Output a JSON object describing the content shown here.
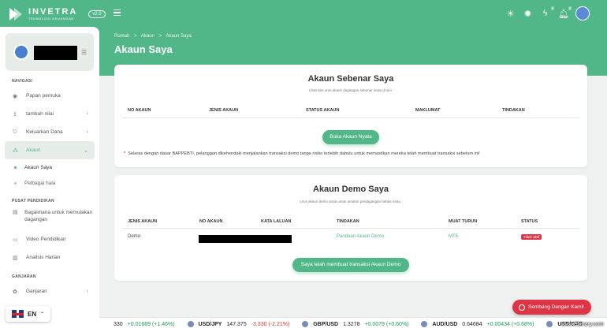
{
  "header": {
    "logo_name": "INVETRA",
    "logo_sub": "TEKNOLOGI KEUANGAN",
    "logo_badge": "v2.0",
    "notif_counts": [
      "0",
      "2"
    ],
    "icons": [
      "sun-icon",
      "settings-icon",
      "lightning-icon",
      "bell-icon"
    ]
  },
  "breadcrumb": [
    "Rumah",
    ">",
    "Akaun",
    ">",
    "Akaun Saya"
  ],
  "page_title": "Akaun Saya",
  "sidebar": {
    "section_nav": "NAVIGASI",
    "items": [
      {
        "label": "Papan pemuka",
        "icon": "dashboard-icon"
      },
      {
        "label": "tambah nilai",
        "icon": "deposit-icon"
      },
      {
        "label": "Keluarkan Dana",
        "icon": "withdraw-icon"
      },
      {
        "label": "Akaun",
        "icon": "account-icon"
      }
    ],
    "sub_items": [
      "Akaun Saya",
      "Pelbagai hala"
    ],
    "section_edu": "PUSAT PENDIDIKAN",
    "edu_items": [
      {
        "label": "Bagaimana untuk memulakan dagangan"
      },
      {
        "label": "Video Pendidikan"
      },
      {
        "label": "Analisis Harian"
      }
    ],
    "section_reward": "GANJARAN",
    "reward_items": [
      {
        "label": "Ganjaran"
      }
    ],
    "language": "EN"
  },
  "real_account": {
    "title": "Akaun Sebenar Saya",
    "subtitle": "Lihat dan urus akaun dagangan sebenar anda di sini.",
    "columns": [
      "NO AKAUN",
      "JENIS AKAUN",
      "STATUS AKAUN",
      "MAKLUMAT",
      "TINDAKAN"
    ],
    "button": "Buka Akaun Nyata",
    "note_star": "*",
    "note": "Selaras dengan dasar BAPPEBTI, pelanggan dikehendaki menjalankan transaksi demo tanpa risiko terlebih dahulu untuk memastikan mereka telah membuat transaksi sebelum ini!"
  },
  "demo_account": {
    "title": "Akaun Demo Saya",
    "subtitle": "Urus akaun demo anda untuk amalan perdagangan bebas risiko.",
    "columns": [
      "JENIS AKAUN",
      "NO AKAUN",
      "KATA LALUAN",
      "TINDAKAN",
      "MUAT TURUN",
      "STATUS"
    ],
    "row": {
      "type": "Demo",
      "action": "Panduan Akaun Demo",
      "download": "MT5",
      "status": "Tidak aktif"
    },
    "button": "Saya telah membuat transaksi Akaun Demo"
  },
  "whatsapp": {
    "label": "Sembang Dengan Kami!"
  },
  "ticker": [
    {
      "sym": "",
      "price": "330",
      "chg": "+0.01669 (+1.46%)",
      "dir": "up"
    },
    {
      "sym": "USD/JPY",
      "price": "147.375",
      "chg": "-3.330 (-2.21%)",
      "dir": "down"
    },
    {
      "sym": "GBP/USD",
      "price": "1.3278",
      "chg": "+0.0079 (+0.60%)",
      "dir": "up"
    },
    {
      "sym": "AUD/USD",
      "price": "0.64684",
      "chg": "+0.00434 (+0.68%)",
      "dir": "up"
    },
    {
      "sym": "USD/CAD",
      "price": "",
      "chg": "",
      "dir": "up"
    }
  ],
  "watermark": "www.8binary.com",
  "colors": {
    "brand": "#52b788",
    "danger": "#dc3545"
  }
}
